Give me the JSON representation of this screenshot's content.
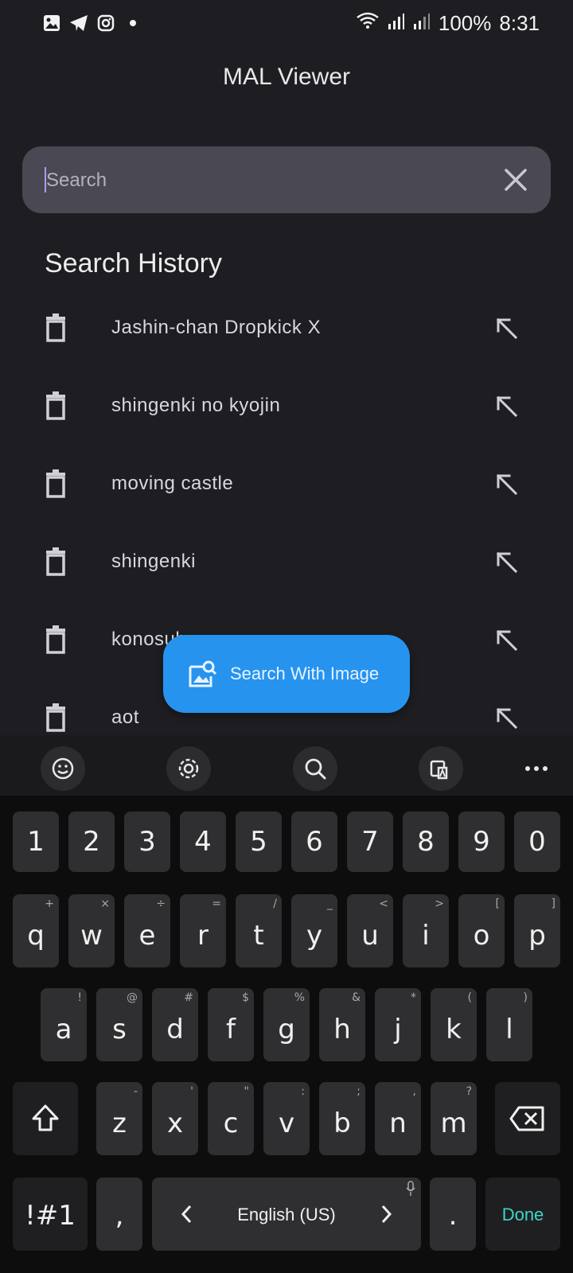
{
  "status_bar": {
    "battery": "100%",
    "time": "8:31",
    "icons_left": [
      "gallery-icon",
      "telegram-icon",
      "instagram-icon",
      "dot-icon"
    ],
    "icons_right": [
      "wifi-icon",
      "signal-icon",
      "signal-icon-2"
    ]
  },
  "app": {
    "title": "MAL Viewer",
    "search_placeholder": "Search",
    "search_value": ""
  },
  "history": {
    "title": "Search History",
    "items": [
      {
        "label": "Jashin-chan Dropkick X"
      },
      {
        "label": "shingenki no kyojin"
      },
      {
        "label": "moving castle"
      },
      {
        "label": "shingenki"
      },
      {
        "label": "konosuba"
      },
      {
        "label": "aot"
      }
    ]
  },
  "fab": {
    "label": "Search With Image"
  },
  "keyboard": {
    "toolbar": [
      "emoji-icon",
      "settings-icon",
      "search-icon",
      "translate-image-icon",
      "more-icon"
    ],
    "numbers": [
      "1",
      "2",
      "3",
      "4",
      "5",
      "6",
      "7",
      "8",
      "9",
      "0"
    ],
    "row1": [
      [
        "q",
        "+"
      ],
      [
        "w",
        "×"
      ],
      [
        "e",
        "÷"
      ],
      [
        "r",
        "="
      ],
      [
        "t",
        "/"
      ],
      [
        "y",
        "_"
      ],
      [
        "u",
        "<"
      ],
      [
        "i",
        ">"
      ],
      [
        "o",
        "["
      ],
      [
        "p",
        "]"
      ]
    ],
    "row2": [
      [
        "a",
        "!"
      ],
      [
        "s",
        "@"
      ],
      [
        "d",
        "#"
      ],
      [
        "f",
        "$"
      ],
      [
        "g",
        "%"
      ],
      [
        "h",
        "&"
      ],
      [
        "j",
        "*"
      ],
      [
        "k",
        "("
      ],
      [
        "l",
        ")"
      ]
    ],
    "row3": [
      [
        "z",
        "-"
      ],
      [
        "x",
        "'"
      ],
      [
        "c",
        "\""
      ],
      [
        "v",
        ":"
      ],
      [
        "b",
        ";"
      ],
      [
        "n",
        ","
      ],
      [
        "m",
        "?"
      ]
    ],
    "symbols_label": "!#1",
    "comma": ",",
    "language": "English (US)",
    "period": ".",
    "done_label": "Done",
    "done_color": "#3fd4c9",
    "fab_color": "#2693ef"
  }
}
